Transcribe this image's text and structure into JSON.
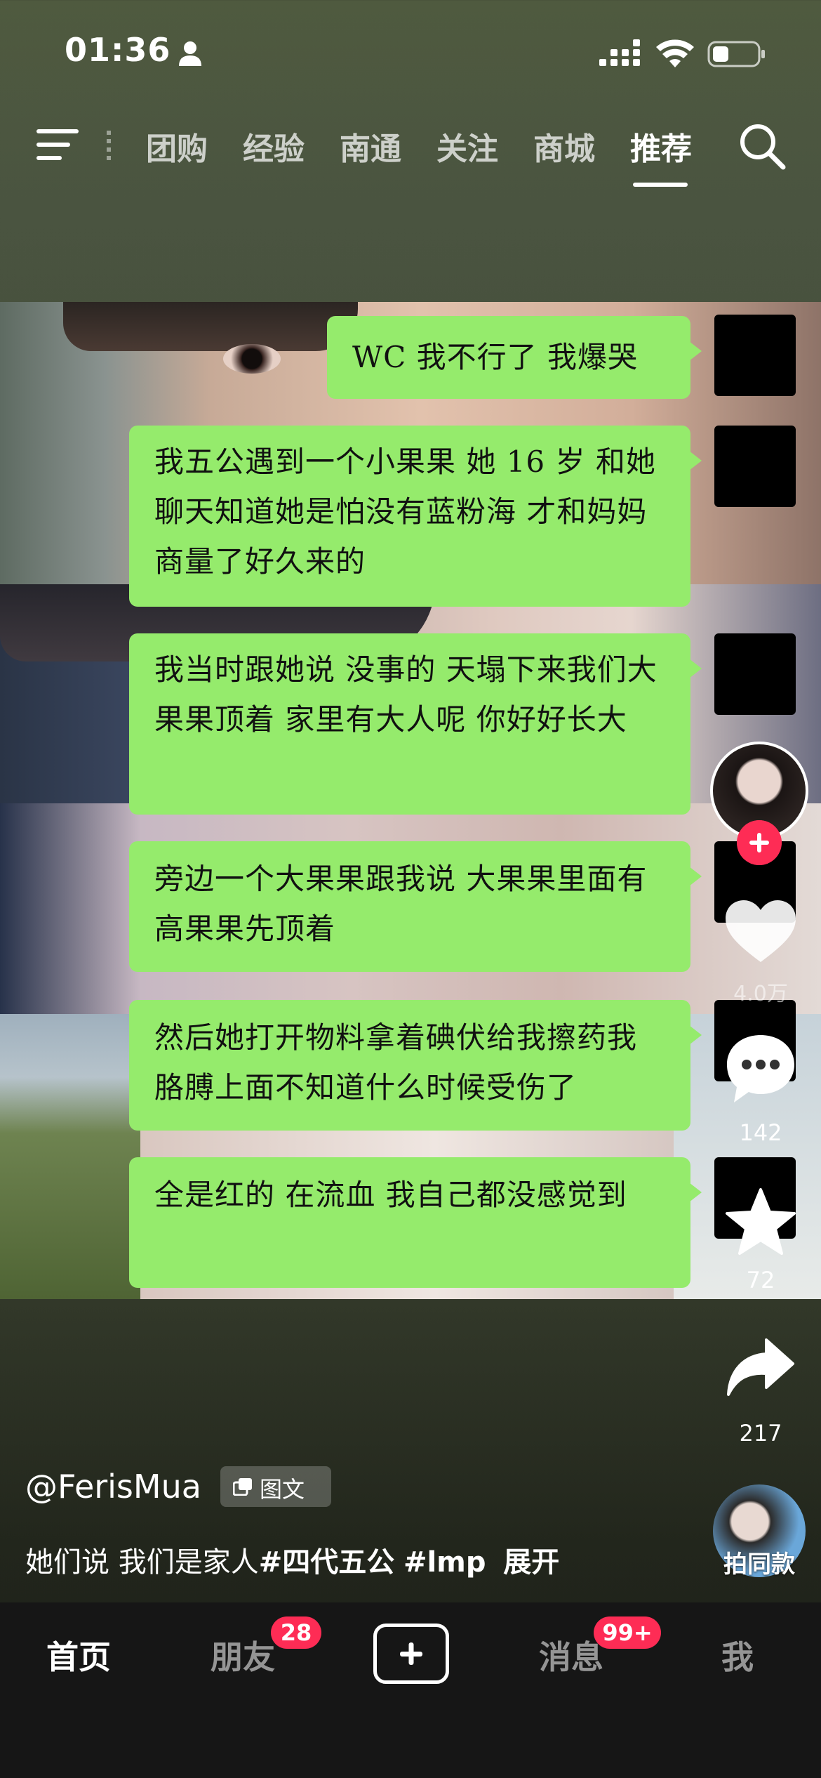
{
  "status": {
    "time": "01:36"
  },
  "nav": {
    "tabs": [
      "团购",
      "经验",
      "南通",
      "关注",
      "商城",
      "推荐"
    ],
    "active_tab": "推荐"
  },
  "chat": {
    "messages": [
      "WC 我不行了 我爆哭",
      "我五公遇到一个小果果 她 16 岁 和她聊天知道她是怕没有蓝粉海 才和妈妈商量了好久来的",
      "我当时跟她说 没事的 天塌下来我们大果果顶着 家里有大人呢 你好好长大",
      "旁边一个大果果跟我说 大果果里面有高果果先顶着",
      "然后她打开物料拿着碘伏给我擦药我胳膊上面不知道什么时候受伤了",
      "全是红的 在流血 我自己都没感觉到"
    ]
  },
  "actions": {
    "likes": "4.0万",
    "comments": "142",
    "favorites": "72",
    "shares": "217",
    "same_style_label": "拍同款"
  },
  "post": {
    "author": "@FerisMua",
    "type_label": "图文",
    "caption_text": "她们说 我们是家人",
    "hashtags": [
      "#四代五公",
      "#lmp"
    ],
    "expand_label": "展开"
  },
  "bottom_nav": {
    "home": "首页",
    "friends": "朋友",
    "friends_badge": "28",
    "messages": "消息",
    "messages_badge": "99+",
    "me": "我"
  },
  "colors": {
    "bubble": "#95eb6c",
    "accent": "#fe2c55"
  }
}
